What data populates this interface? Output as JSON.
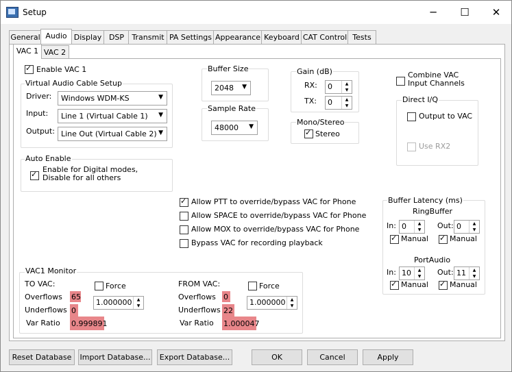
{
  "window": {
    "title": "Setup",
    "min": "─",
    "max": "☐",
    "close": "✕"
  },
  "tabs": [
    "General",
    "Audio",
    "Display",
    "DSP",
    "Transmit",
    "PA Settings",
    "Appearance",
    "Keyboard",
    "CAT Control",
    "Tests"
  ],
  "subtabs": [
    "VAC 1",
    "VAC 2"
  ],
  "enable_vac1": "Enable VAC 1",
  "vac_setup": {
    "title": "Virtual Audio Cable Setup",
    "driver_label": "Driver:",
    "driver_value": "Windows WDM-KS",
    "input_label": "Input:",
    "input_value": "Line 1 (Virtual Cable 1)",
    "output_label": "Output:",
    "output_value": "Line Out (Virtual Cable 2)"
  },
  "buffer_size": {
    "title": "Buffer Size",
    "value": "2048"
  },
  "sample_rate": {
    "title": "Sample Rate",
    "value": "48000"
  },
  "gain": {
    "title": "Gain (dB)",
    "rx_label": "RX:",
    "rx_value": "0",
    "tx_label": "TX:",
    "tx_value": "0"
  },
  "mono_stereo": {
    "title": "Mono/Stereo",
    "stereo_label": "Stereo"
  },
  "combine_vac": "Combine VAC Input Channels",
  "direct_iq": {
    "title": "Direct I/Q",
    "output_to_vac": "Output to VAC",
    "use_rx2": "Use RX2"
  },
  "auto_enable": {
    "title": "Auto Enable",
    "option": "Enable for Digital modes, Disable for all others"
  },
  "options": {
    "ptt": "Allow PTT to override/bypass VAC for Phone",
    "space": "Allow SPACE to override/bypass VAC for Phone",
    "mox": "Allow MOX to override/bypass VAC for Phone",
    "bypass": "Bypass VAC for recording playback"
  },
  "latency": {
    "title": "Buffer Latency (ms)",
    "ringbuffer": "RingBuffer",
    "portaudio": "PortAudio",
    "in_label": "In:",
    "out_label": "Out:",
    "manual": "Manual",
    "rb_in": "0",
    "rb_out": "0",
    "pa_in": "10",
    "pa_out": "11"
  },
  "monitor": {
    "title": "VAC1 Monitor",
    "to_vac": "TO VAC:",
    "from_vac": "FROM VAC:",
    "force": "Force",
    "overflows": "Overflows",
    "underflows": "Underflows",
    "var_ratio": "Var Ratio",
    "to_overflows": "65",
    "to_underflows": "0",
    "to_var_ratio": "0.999891",
    "from_overflows": "0",
    "from_underflows": "22",
    "from_var_ratio": "1.000047",
    "to_force_value": "1.000000",
    "from_force_value": "1.000000"
  },
  "buttons": {
    "reset_db": "Reset Database",
    "import_db": "Import Database...",
    "export_db": "Export Database...",
    "ok": "OK",
    "cancel": "Cancel",
    "apply": "Apply"
  }
}
